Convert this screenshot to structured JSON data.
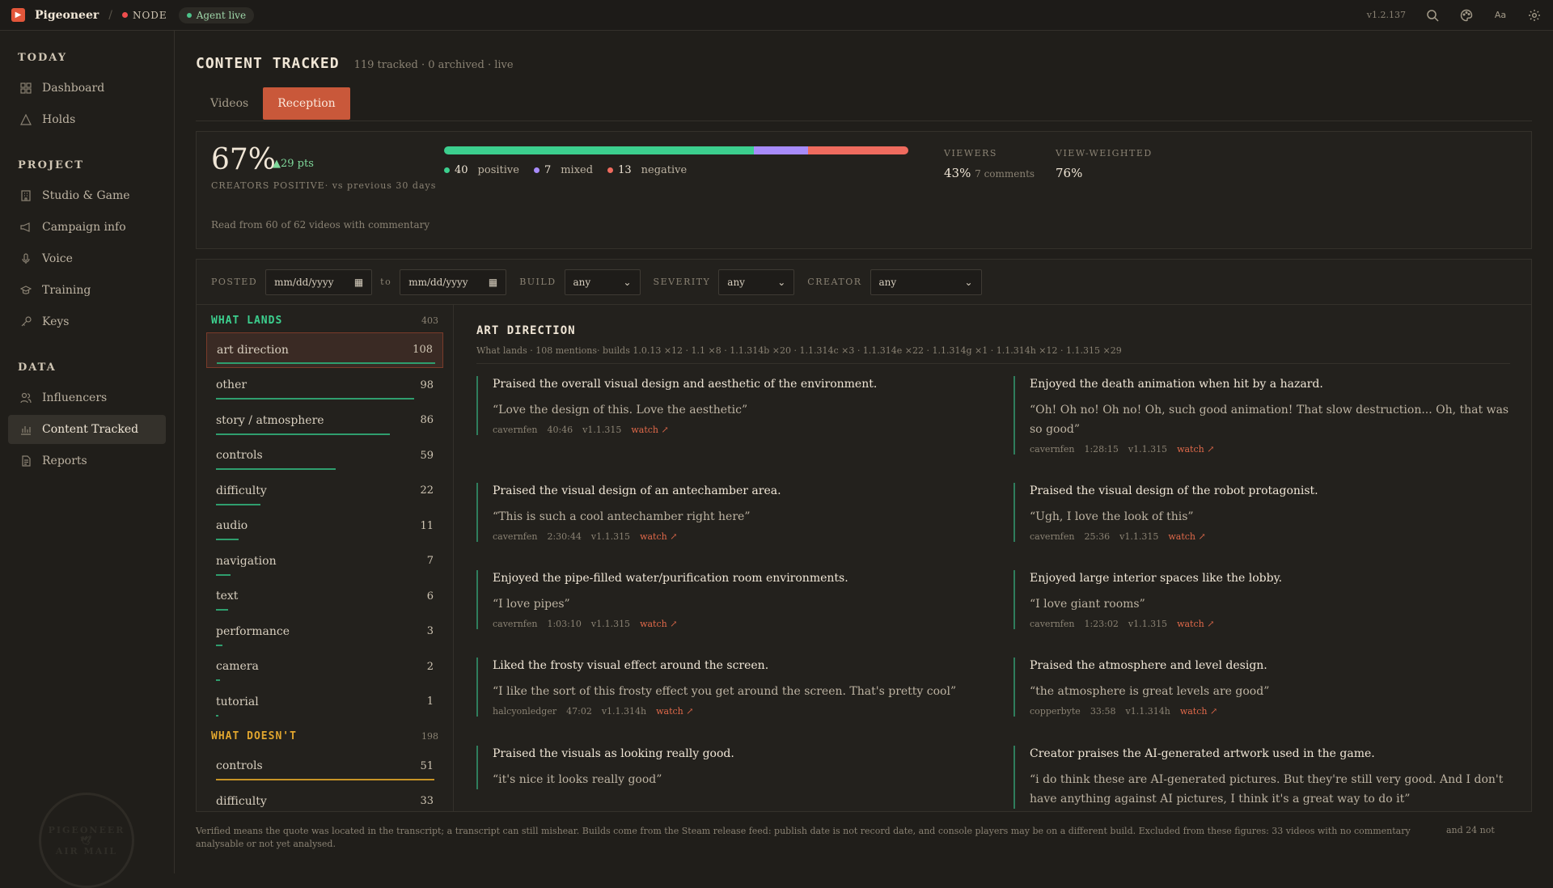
{
  "app": {
    "name": "Pigeoneer",
    "node_label": "NODE",
    "agent_status": "Agent live",
    "version": "v1.2.137",
    "font_btn": "Aa",
    "colors": {
      "accent": "#c9583a",
      "positive": "#3ccf8e",
      "mixed": "#a78bfa",
      "negative": "#ef6b5e",
      "live": "#4cc38a"
    }
  },
  "sidebar": {
    "sections": [
      {
        "label": "TODAY",
        "items": [
          {
            "label": "Dashboard",
            "icon": "grid-icon"
          },
          {
            "label": "Holds",
            "icon": "warning-icon"
          }
        ]
      },
      {
        "label": "PROJECT",
        "items": [
          {
            "label": "Studio & Game",
            "icon": "building-icon"
          },
          {
            "label": "Campaign info",
            "icon": "megaphone-icon"
          },
          {
            "label": "Voice",
            "icon": "mic-icon"
          },
          {
            "label": "Training",
            "icon": "graduation-cap-icon"
          },
          {
            "label": "Keys",
            "icon": "key-icon"
          }
        ]
      },
      {
        "label": "DATA",
        "items": [
          {
            "label": "Influencers",
            "icon": "users-icon"
          },
          {
            "label": "Content Tracked",
            "icon": "bar-chart-icon",
            "active": true
          },
          {
            "label": "Reports",
            "icon": "document-icon"
          }
        ]
      }
    ],
    "stamp_text": "PIGEONEER AIR MAIL"
  },
  "header": {
    "title": "CONTENT TRACKED",
    "subtitle": "119 tracked · 0 archived · live",
    "tabs": [
      {
        "label": "Videos"
      },
      {
        "label": "Reception",
        "active": true
      }
    ]
  },
  "summary": {
    "percent": "67%",
    "delta": "▲29 pts",
    "caption": "CREATORS POSITIVE· vs previous 30 days",
    "read_from": "Read from 60 of 62 videos with commentary",
    "positive": 40,
    "mixed": 7,
    "negative": 13,
    "positive_label": "positive",
    "mixed_label": "mixed",
    "negative_label": "negative",
    "viewers_label": "VIEWERS",
    "viewers_value": "43%",
    "viewers_note": "7 comments",
    "weighted_label": "VIEW-WEIGHTED",
    "weighted_value": "76%"
  },
  "filters": {
    "posted_label": "POSTED",
    "from_placeholder": "mm/dd/yyyy",
    "to_label": "to",
    "to_placeholder": "mm/dd/yyyy",
    "build_label": "BUILD",
    "build_value": "any",
    "severity_label": "SEVERITY",
    "severity_value": "any",
    "creator_label": "CREATOR",
    "creator_value": "any"
  },
  "lands": {
    "label": "WHAT LANDS",
    "total": "403",
    "items": [
      {
        "label": "art direction",
        "count": 108
      },
      {
        "label": "other",
        "count": 98
      },
      {
        "label": "story / atmosphere",
        "count": 86
      },
      {
        "label": "controls",
        "count": 59
      },
      {
        "label": "difficulty",
        "count": 22
      },
      {
        "label": "audio",
        "count": 11
      },
      {
        "label": "navigation",
        "count": 7
      },
      {
        "label": "text",
        "count": 6
      },
      {
        "label": "performance",
        "count": 3
      },
      {
        "label": "camera",
        "count": 2
      },
      {
        "label": "tutorial",
        "count": 1
      }
    ]
  },
  "doesnt": {
    "label": "WHAT DOESN'T",
    "total": "198",
    "items": [
      {
        "label": "controls",
        "count": 51
      },
      {
        "label": "difficulty",
        "count": 33
      }
    ]
  },
  "detail": {
    "title": "ART DIRECTION",
    "subtitle": "What lands · 108 mentions· builds 1.0.13 ×12 · 1.1 ×8 · 1.1.314b ×20 · 1.1.314c ×3 · 1.1.314e ×22 · 1.1.314g ×1 · 1.1.314h ×12 · 1.1.315 ×29",
    "watch_label": "watch ↗",
    "quotes": [
      {
        "summary": "Praised the overall visual design and aesthetic of the environment.",
        "quote": "“Love the design of this. Love the aesthetic”",
        "creator": "cavernfen",
        "time": "40:46",
        "build": "v1.1.315"
      },
      {
        "summary": "Enjoyed the death animation when hit by a hazard.",
        "quote": "“Oh! Oh no! Oh no! Oh, such good animation! That slow destruction... Oh, that was so good”",
        "creator": "cavernfen",
        "time": "1:28:15",
        "build": "v1.1.315"
      },
      {
        "summary": "Praised the visual design of an antechamber area.",
        "quote": "“This is such a cool antechamber right here”",
        "creator": "cavernfen",
        "time": "2:30:44",
        "build": "v1.1.315"
      },
      {
        "summary": "Praised the visual design of the robot protagonist.",
        "quote": "“Ugh, I love the look of this”",
        "creator": "cavernfen",
        "time": "25:36",
        "build": "v1.1.315"
      },
      {
        "summary": "Enjoyed the pipe-filled water/purification room environments.",
        "quote": "“I love pipes”",
        "creator": "cavernfen",
        "time": "1:03:10",
        "build": "v1.1.315"
      },
      {
        "summary": "Enjoyed large interior spaces like the lobby.",
        "quote": "“I love giant rooms”",
        "creator": "cavernfen",
        "time": "1:23:02",
        "build": "v1.1.315"
      },
      {
        "summary": "Liked the frosty visual effect around the screen.",
        "quote": "“I like the sort of this frosty effect you get around the screen. That's pretty cool”",
        "creator": "halcyonledger",
        "time": "47:02",
        "build": "v1.1.314h"
      },
      {
        "summary": "Praised the atmosphere and level design.",
        "quote": "“the atmosphere is great levels are good”",
        "creator": "copperbyte",
        "time": "33:58",
        "build": "v1.1.314h"
      },
      {
        "summary": "Praised the visuals as looking really good.",
        "quote": "“it's nice it looks really good”",
        "creator": "",
        "time": "",
        "build": ""
      },
      {
        "summary": "Creator praises the AI-generated artwork used in the game.",
        "quote": "“i do think these are AI-generated pictures. But they're still very good. And I don't have anything against AI pictures, I think it's a great way to do it”",
        "creator": "",
        "time": "",
        "build": ""
      }
    ]
  },
  "footer": {
    "note": "Verified means the quote was located in the transcript; a transcript can still mishear. Builds come from the Steam release feed: publish date is not record date, and console players may be on a different build. Excluded from these figures: 33 videos with no commentary",
    "note2": "and 24 not",
    "note3": "analysable or not yet analysed."
  }
}
